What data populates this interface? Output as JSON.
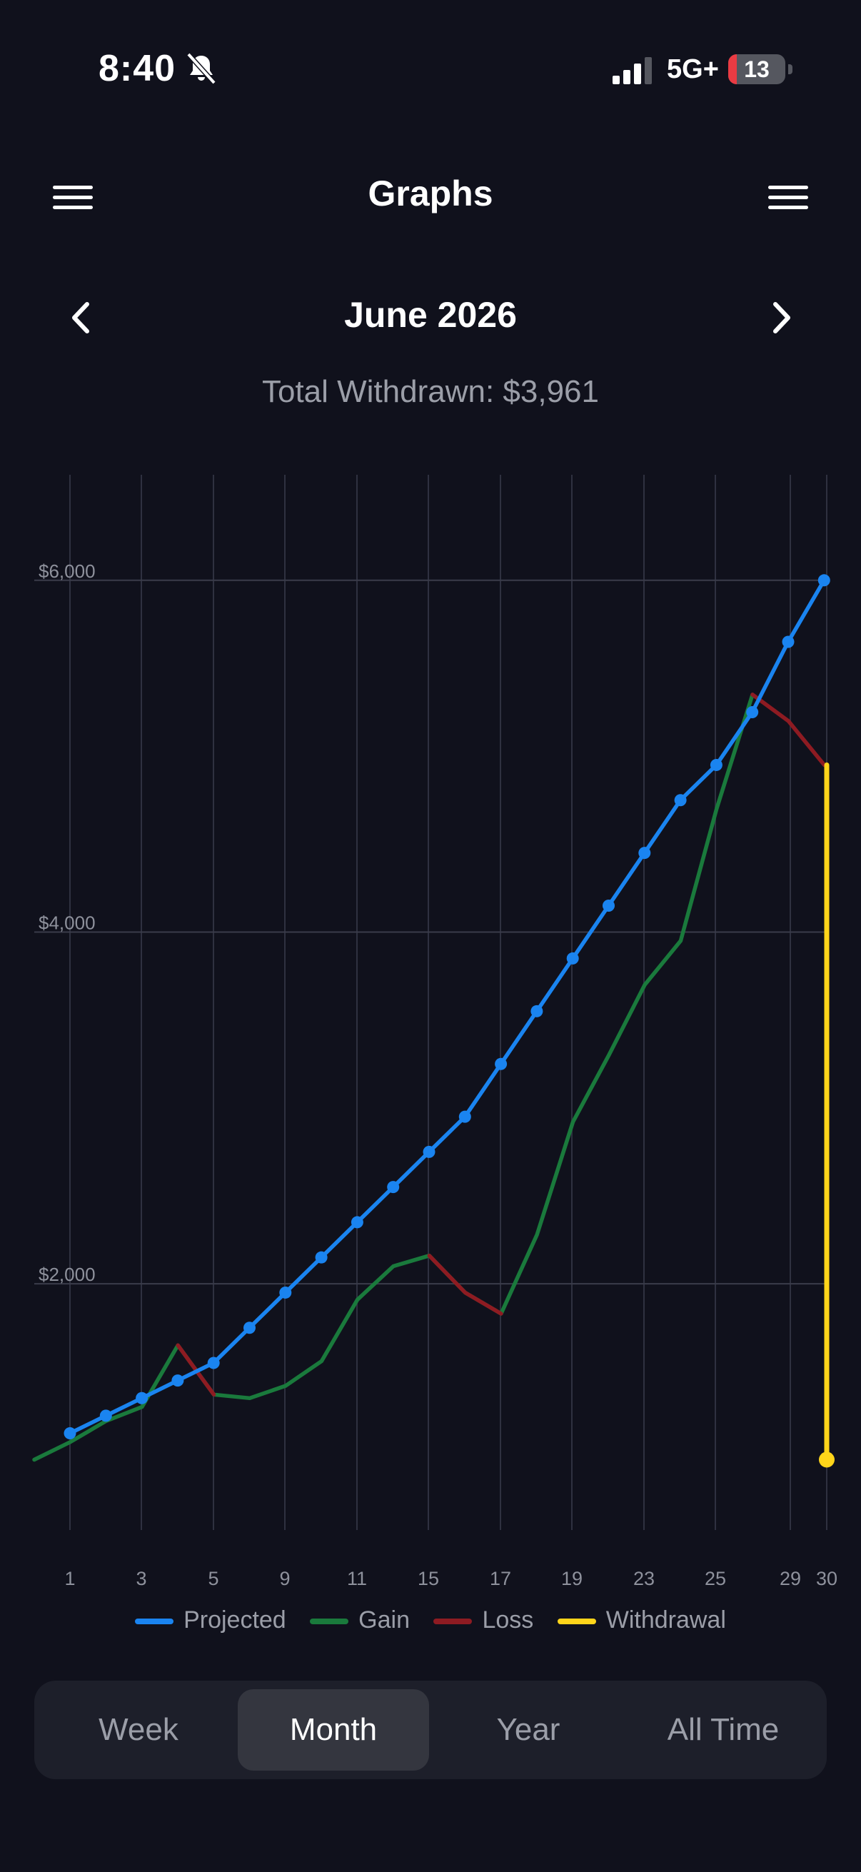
{
  "status_bar": {
    "time": "8:40",
    "network": "5G+",
    "battery": "13"
  },
  "header": {
    "title": "Graphs"
  },
  "month_nav": {
    "label": "June 2026"
  },
  "summary": {
    "total_withdrawn": "Total Withdrawn: $3,961"
  },
  "chart_data": {
    "type": "line",
    "x_ticks": [
      "1",
      "3",
      "5",
      "9",
      "11",
      "15",
      "17",
      "19",
      "23",
      "25",
      "29",
      "30"
    ],
    "y_ticks": [
      "$6,000",
      "$4,000",
      "$2,000"
    ],
    "ylim": [
      600,
      6600
    ],
    "grid": true,
    "legend_position": "bottom",
    "series": [
      {
        "name": "Projected",
        "color": "#1a84f0",
        "values": [
          1150,
          1250,
          1350,
          1450,
          1550,
          1750,
          1950,
          2150,
          2350,
          2550,
          2750,
          2950,
          3250,
          3550,
          3850,
          4150,
          4450,
          4750,
          4950,
          5250,
          5650,
          6000
        ]
      },
      {
        "name": "Gain",
        "color": "#1a7a3c",
        "values": [
          1000,
          1100,
          1220,
          1300,
          1650,
          1370,
          1350,
          1420,
          1560,
          1910,
          2100,
          2160,
          1950,
          1830,
          2280,
          2920,
          3300,
          3700,
          3950,
          4700,
          5350
        ]
      },
      {
        "name": "Loss",
        "color": "#8e1b22",
        "values": [
          1650,
          1370,
          2160,
          1950,
          1830,
          5350,
          5200,
          4950
        ]
      },
      {
        "name": "Withdrawal",
        "color": "#ffd51a",
        "values": [
          4950,
          1000
        ]
      }
    ]
  },
  "tabs": [
    {
      "label": "Week"
    },
    {
      "label": "Month",
      "active": true
    },
    {
      "label": "Year"
    },
    {
      "label": "All Time"
    }
  ]
}
